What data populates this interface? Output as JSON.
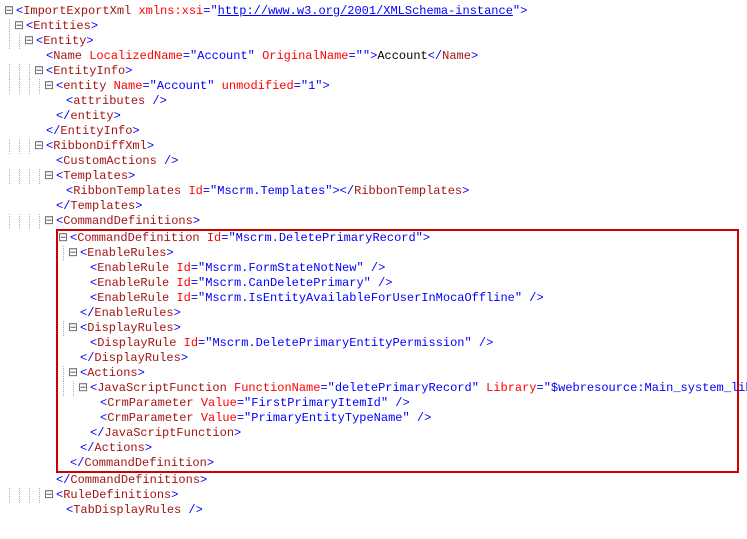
{
  "xmlns_xsi_url": "http://www.w3.org/2001/XMLSchema-instance",
  "name_localized": "Account",
  "name_original": "",
  "name_text": "Account",
  "entity_name": "Account",
  "entity_unmodified": "1",
  "ribbon_templates_id": "Mscrm.Templates",
  "cmd_def_id": "Mscrm.DeletePrimaryRecord",
  "enable_rule_1": "Mscrm.FormStateNotNew",
  "enable_rule_2": "Mscrm.CanDeletePrimary",
  "enable_rule_3": "Mscrm.IsEntityAvailableForUserInMocaOffline",
  "display_rule_1": "Mscrm.DeletePrimaryEntityPermission",
  "js_function_name": "deletePrimaryRecord",
  "js_library": "$webresource:Main_system_library.js",
  "crm_param_1": "FirstPrimaryItemId",
  "crm_param_2": "PrimaryEntityTypeName",
  "tags": {
    "ImportExportXml": "ImportExportXml",
    "Entities": "Entities",
    "Entity": "Entity",
    "Name": "Name",
    "EntityInfo": "EntityInfo",
    "entity": "entity",
    "attributes": "attributes",
    "RibbonDiffXml": "RibbonDiffXml",
    "CustomActions": "CustomActions",
    "Templates": "Templates",
    "RibbonTemplates": "RibbonTemplates",
    "CommandDefinitions": "CommandDefinitions",
    "CommandDefinition": "CommandDefinition",
    "EnableRules": "EnableRules",
    "EnableRule": "EnableRule",
    "DisplayRules": "DisplayRules",
    "DisplayRule": "DisplayRule",
    "Actions": "Actions",
    "JavaScriptFunction": "JavaScriptFunction",
    "CrmParameter": "CrmParameter",
    "RuleDefinitions": "RuleDefinitions",
    "TabDisplayRules": "TabDisplayRules"
  },
  "attrs": {
    "xmlns_xsi": "xmlns:xsi",
    "LocalizedName": "LocalizedName",
    "OriginalName": "OriginalName",
    "Name": "Name",
    "unmodified": "unmodified",
    "Id": "Id",
    "FunctionName": "FunctionName",
    "Library": "Library",
    "Value": "Value"
  }
}
